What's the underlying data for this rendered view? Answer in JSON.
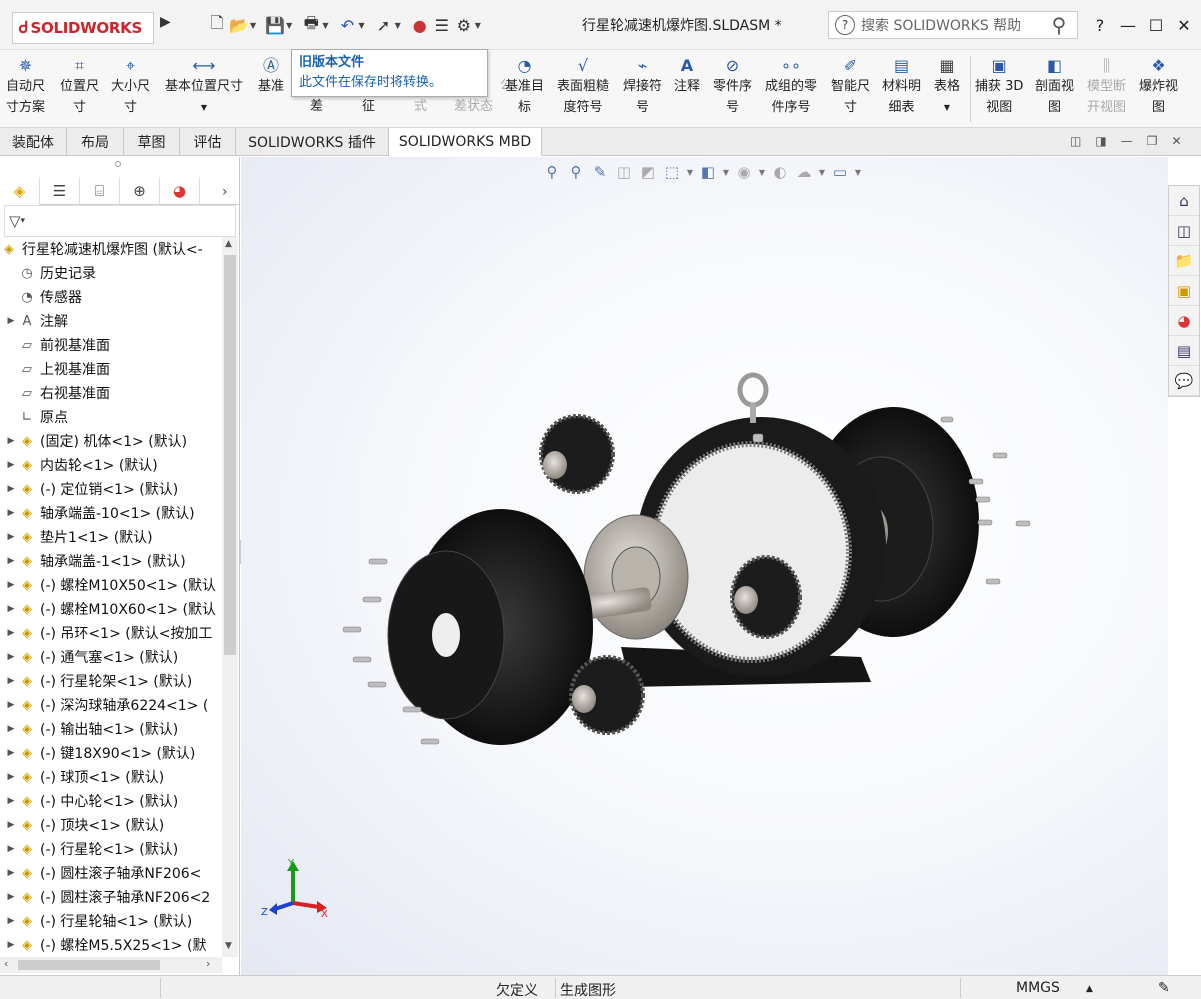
{
  "app": {
    "brand": "SOLIDWORKS",
    "document_title": "行星轮减速机爆炸图.SLDASM *"
  },
  "search": {
    "placeholder": "搜索 SOLIDWORKS 帮助"
  },
  "titlebar_buttons": {
    "help": "?",
    "minimize": "—",
    "maximize": "☐",
    "close": "✕"
  },
  "ribbon": {
    "items": [
      {
        "label1": "自动尺",
        "label2": "寸方案",
        "icon": "auto-dimension-icon"
      },
      {
        "label1": "位置尺",
        "label2": "寸",
        "icon": "location-dimension-icon"
      },
      {
        "label1": "大小尺",
        "label2": "寸",
        "icon": "size-dimension-icon"
      },
      {
        "label1": "基本位置尺寸",
        "label2": "",
        "icon": "basic-location-dimension-icon"
      },
      {
        "label1": "基准",
        "label2": "",
        "icon": "datum-icon"
      },
      {
        "label1": "",
        "label2": "差",
        "icon": ""
      },
      {
        "label1": "",
        "label2": "征",
        "icon": ""
      },
      {
        "label1": "",
        "label2": "式",
        "icon": ""
      },
      {
        "label1": "公",
        "label2": "差状态",
        "icon": ""
      },
      {
        "label1": "基准目",
        "label2": "标",
        "icon": "datum-target-icon"
      },
      {
        "label1": "表面粗糙",
        "label2": "度符号",
        "icon": "surface-finish-icon"
      },
      {
        "label1": "焊接符",
        "label2": "号",
        "icon": "weld-symbol-icon"
      },
      {
        "label1": "注释",
        "label2": "",
        "icon": "note-icon"
      },
      {
        "label1": "零件序",
        "label2": "号",
        "icon": "balloon-icon"
      },
      {
        "label1": "成组的零",
        "label2": "件序号",
        "icon": "stacked-balloon-icon"
      },
      {
        "label1": "智能尺",
        "label2": "寸",
        "icon": "smart-dimension-icon"
      },
      {
        "label1": "材料明",
        "label2": "细表",
        "icon": "bom-icon"
      },
      {
        "label1": "表格",
        "label2": "",
        "icon": "table-icon"
      },
      {
        "label1": "捕获 3D",
        "label2": "视图",
        "icon": "capture-3d-view-icon"
      },
      {
        "label1": "剖面视",
        "label2": "图",
        "icon": "section-view-icon"
      },
      {
        "label1": "模型断",
        "label2": "开视图",
        "icon": "model-break-view-icon"
      },
      {
        "label1": "爆炸视",
        "label2": "图",
        "icon": "exploded-view-icon"
      }
    ]
  },
  "tooltip": {
    "title": "旧版本文件",
    "body": "此文件在保存时将转换。"
  },
  "tabs": [
    {
      "label": "装配体",
      "active": false
    },
    {
      "label": "布局",
      "active": false
    },
    {
      "label": "草图",
      "active": false
    },
    {
      "label": "评估",
      "active": false
    },
    {
      "label": "SOLIDWORKS 插件",
      "active": false
    },
    {
      "label": "SOLIDWORKS MBD",
      "active": true
    }
  ],
  "tree": {
    "root": "行星轮减速机爆炸图  (默认<-",
    "items": [
      {
        "label": "历史记录",
        "expandable": false,
        "icon": "history-icon"
      },
      {
        "label": "传感器",
        "expandable": false,
        "icon": "sensor-icon"
      },
      {
        "label": "注解",
        "expandable": true,
        "icon": "annotation-icon"
      },
      {
        "label": "前视基准面",
        "expandable": false,
        "icon": "plane-icon"
      },
      {
        "label": "上视基准面",
        "expandable": false,
        "icon": "plane-icon"
      },
      {
        "label": "右视基准面",
        "expandable": false,
        "icon": "plane-icon"
      },
      {
        "label": "原点",
        "expandable": false,
        "icon": "origin-icon"
      },
      {
        "label": "(固定) 机体<1> (默认)",
        "expandable": true,
        "icon": "part-icon"
      },
      {
        "label": "内齿轮<1> (默认)",
        "expandable": true,
        "icon": "part-icon"
      },
      {
        "label": "(-) 定位销<1> (默认)",
        "expandable": true,
        "icon": "part-icon"
      },
      {
        "label": "轴承端盖-10<1> (默认)",
        "expandable": true,
        "icon": "part-icon"
      },
      {
        "label": "垫片1<1> (默认)",
        "expandable": true,
        "icon": "part-icon"
      },
      {
        "label": "轴承端盖-1<1> (默认)",
        "expandable": true,
        "icon": "part-icon"
      },
      {
        "label": "(-) 螺栓M10X50<1> (默认",
        "expandable": true,
        "icon": "part-icon"
      },
      {
        "label": "(-) 螺栓M10X60<1> (默认",
        "expandable": true,
        "icon": "part-icon"
      },
      {
        "label": "(-) 吊环<1> (默认<按加工",
        "expandable": true,
        "icon": "part-icon"
      },
      {
        "label": "(-) 通气塞<1> (默认)",
        "expandable": true,
        "icon": "part-icon"
      },
      {
        "label": "(-) 行星轮架<1> (默认)",
        "expandable": true,
        "icon": "part-icon"
      },
      {
        "label": "(-) 深沟球轴承6224<1> (",
        "expandable": true,
        "icon": "part-icon"
      },
      {
        "label": "(-) 输出轴<1> (默认)",
        "expandable": true,
        "icon": "part-icon"
      },
      {
        "label": "(-) 键18X90<1> (默认)",
        "expandable": true,
        "icon": "part-icon"
      },
      {
        "label": "(-) 球顶<1> (默认)",
        "expandable": true,
        "icon": "part-icon"
      },
      {
        "label": "(-) 中心轮<1> (默认)",
        "expandable": true,
        "icon": "part-icon"
      },
      {
        "label": "(-) 顶块<1> (默认)",
        "expandable": true,
        "icon": "part-icon"
      },
      {
        "label": "(-) 行星轮<1> (默认)",
        "expandable": true,
        "icon": "part-icon"
      },
      {
        "label": "(-) 圆柱滚子轴承NF206<",
        "expandable": true,
        "icon": "part-icon"
      },
      {
        "label": "(-) 圆柱滚子轴承NF206<2",
        "expandable": true,
        "icon": "part-icon"
      },
      {
        "label": "(-) 行星轮轴<1> (默认)",
        "expandable": true,
        "icon": "part-icon"
      },
      {
        "label": "(-) 螺栓M5.5X25<1> (默",
        "expandable": true,
        "icon": "part-icon"
      }
    ]
  },
  "triad": {
    "x": "X",
    "y": "Y",
    "z": "Z"
  },
  "status": {
    "state": "欠定义",
    "action": "生成图形",
    "units": "MMGS"
  },
  "colors": {
    "brand_red": "#d2232a",
    "tooltip_blue": "#1a5fb4",
    "axis_x": "#d62020",
    "axis_y": "#1a9a1a",
    "axis_z": "#2040d0"
  }
}
